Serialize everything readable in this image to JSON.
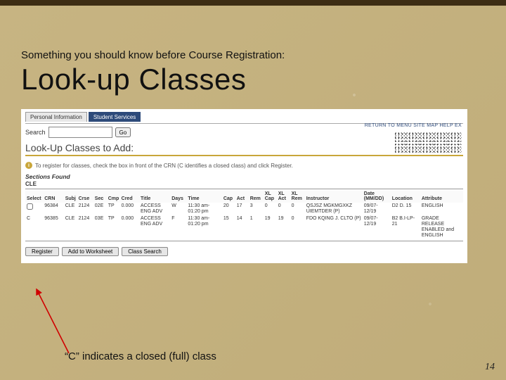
{
  "slide": {
    "subtitle": "Something you should know before Course Registration:",
    "title": "Look-up Classes",
    "annotation": "“C” indicates a closed (full) class",
    "page_number": "14"
  },
  "screenshot": {
    "tabs": {
      "personal": "Personal Information",
      "student": "Student Services"
    },
    "search_label": "Search",
    "go_label": "Go",
    "top_links": "RETURN TO MENU   SITE MAP   HELP   EX",
    "page_heading": "Look-Up Classes to Add:",
    "info_note": "To register for classes, check the box in front of the CRN (C identifies a closed class) and click Register.",
    "sections_found": "Sections Found",
    "subject": "CLE",
    "headers": {
      "select": "Select",
      "crn": "CRN",
      "subj": "Subj",
      "crse": "Crse",
      "sec": "Sec",
      "cmp": "Cmp",
      "cred": "Cred",
      "title": "Title",
      "days": "Days",
      "time": "Time",
      "cap": "Cap",
      "act": "Act",
      "rem": "Rem",
      "xlcap": "XL Cap",
      "xlact": "XL Act",
      "xlrem": "XL Rem",
      "instructor": "Instructor",
      "date": "Date (MM/DD)",
      "location": "Location",
      "attribute": "Attribute"
    },
    "rows": [
      {
        "select": "checkbox",
        "crn": "96384",
        "subj": "CLE",
        "crse": "2124",
        "sec": "02E",
        "cmp": "TP",
        "cred": "0.000",
        "title": "ACCESS ENG ADV",
        "days": "W",
        "time": "11:30 am- 01:20 pm",
        "cap": "20",
        "act": "17",
        "rem": "3",
        "xlcap": "0",
        "xlact": "0",
        "xlrem": "0",
        "instructor": "QSJSZ MGKMGXKZ UIEMTDER (P)",
        "date": "09/07- 12/19",
        "location": "D2 D. 15",
        "attribute": "ENGLISH"
      },
      {
        "select": "C",
        "crn": "96385",
        "subj": "CLE",
        "crse": "2124",
        "sec": "03E",
        "cmp": "TP",
        "cred": "0.000",
        "title": "ACCESS ENG ADV",
        "days": "F",
        "time": "11:30 am- 01:20 pm",
        "cap": "15",
        "act": "14",
        "rem": "1",
        "xlcap": "19",
        "xlact": "19",
        "xlrem": "0",
        "instructor": "FDO KQING J. CLTO (P)",
        "date": "09/07- 12/19",
        "location": "B2 B.I-LP-21",
        "attribute": "GRADE RELEASE ENABLED and ENGLISH"
      }
    ],
    "buttons": {
      "register": "Register",
      "worksheet": "Add to Worksheet",
      "classsearch": "Class Search"
    }
  }
}
